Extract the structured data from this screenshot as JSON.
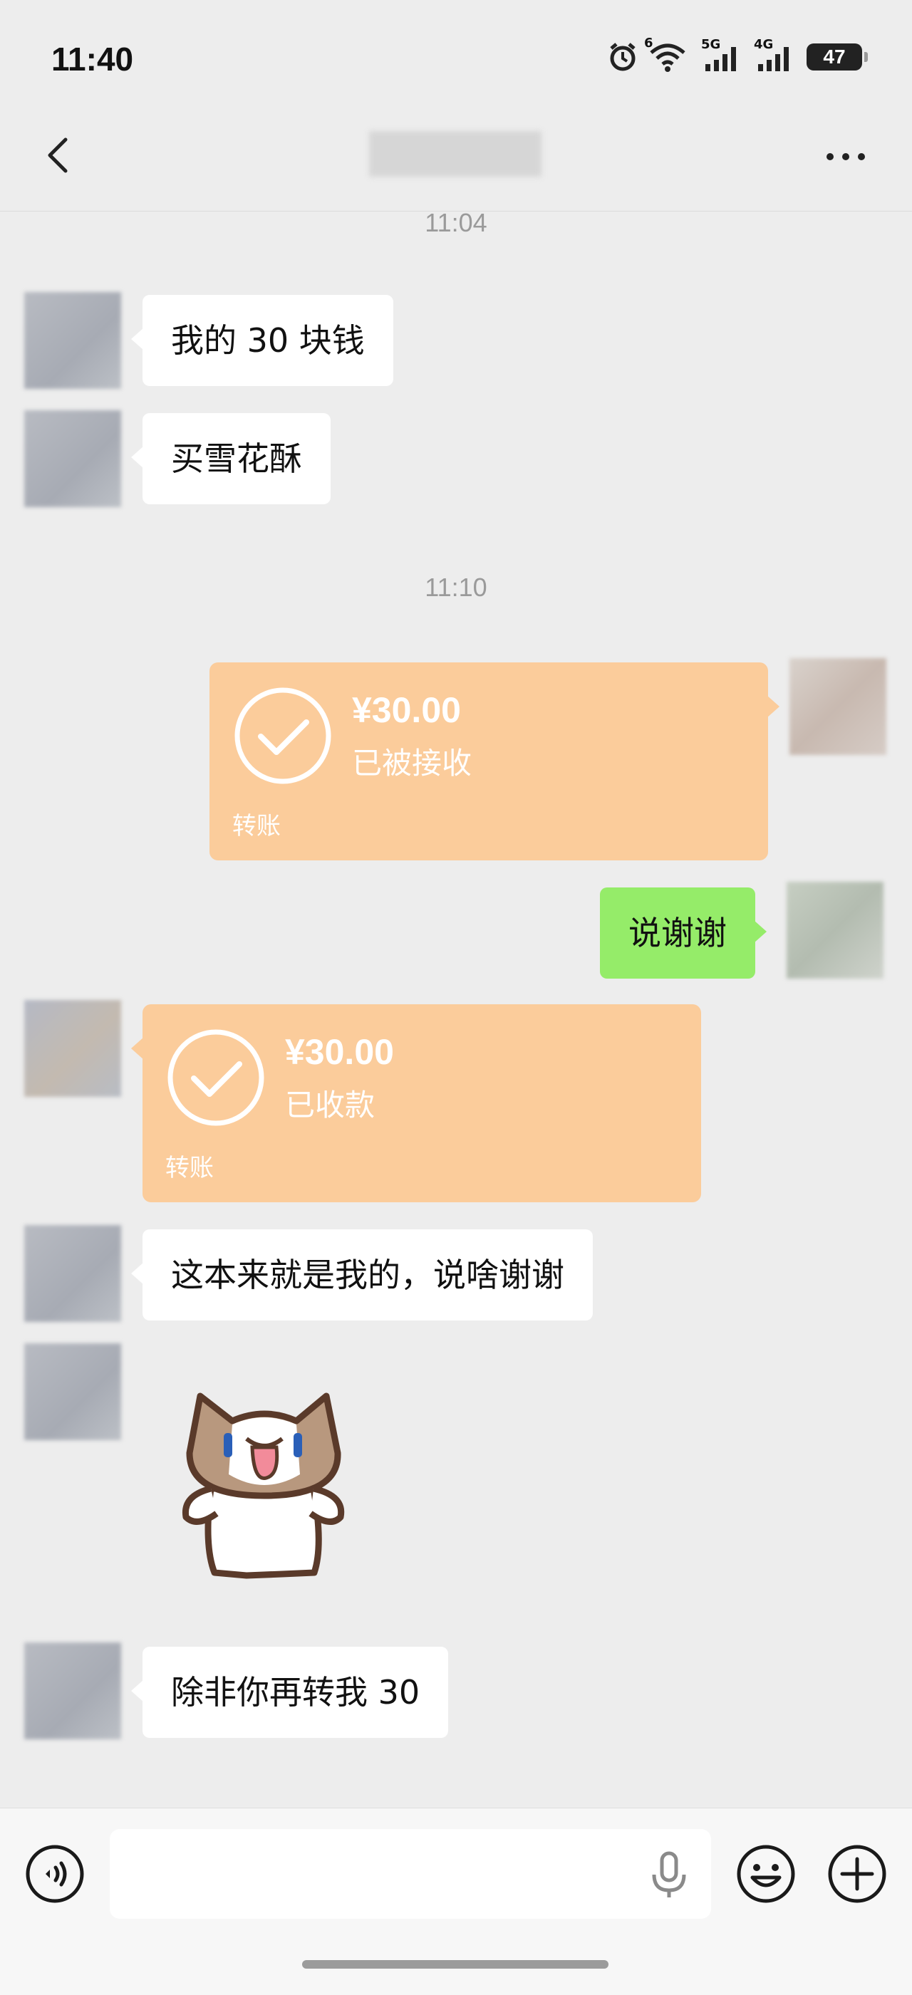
{
  "status_bar": {
    "time": "11:40",
    "battery": "47",
    "signal_labels": [
      "6",
      "5G",
      "4G"
    ]
  },
  "header": {
    "title": ""
  },
  "messages": {
    "ts1": "11:04",
    "m1": "我的 30 块钱",
    "m2": "买雪花酥",
    "ts2": "11:10",
    "t1": {
      "amount": "¥30.00",
      "status": "已被接收",
      "label": "转账"
    },
    "m3": "说谢谢",
    "t2": {
      "amount": "¥30.00",
      "status": "已收款",
      "label": "转账"
    },
    "m4": "这本来就是我的，说啥谢谢",
    "m5": "除非你再转我 30"
  },
  "icons": {
    "back": "chevron-left-icon",
    "more": "more-dots-icon",
    "alarm": "alarm-icon",
    "wifi": "wifi-icon",
    "voice": "voice-icon",
    "mic": "mic-icon",
    "emoji": "emoji-icon",
    "plus": "plus-icon",
    "check": "check-circle-icon"
  },
  "colors": {
    "background": "#ededed",
    "bubble_incoming": "#ffffff",
    "bubble_outgoing": "#95ec69",
    "transfer": "#fbcc9b"
  }
}
